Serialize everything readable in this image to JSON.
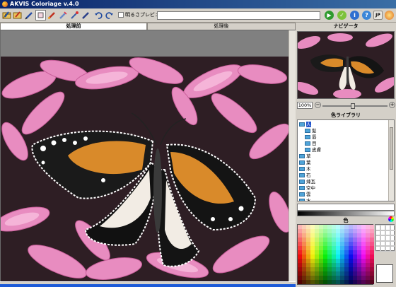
{
  "window": {
    "title": "AKVIS Coloriage v.4.0"
  },
  "toolbar": {
    "preview_label": "明るさプレビュー",
    "language_button": "JP",
    "icons": [
      "open-icon",
      "save-icon",
      "pencil-icon",
      "eraser-icon",
      "brush-icon",
      "lasso-icon",
      "eyedropper-icon",
      "fill-icon",
      "undo-icon",
      "redo-icon",
      "run-icon",
      "apply-icon",
      "info-icon",
      "help-icon",
      "language-icon",
      "settings-icon"
    ]
  },
  "tabs": {
    "before": "処理前",
    "after": "処理後"
  },
  "navigator": {
    "header": "ナビゲータ",
    "zoom": "100%"
  },
  "library": {
    "header": "色ライブラリ",
    "items": [
      {
        "label": "人",
        "indent": 0
      },
      {
        "label": "髪",
        "indent": 1
      },
      {
        "label": "唇",
        "indent": 1
      },
      {
        "label": "目",
        "indent": 1
      },
      {
        "label": "皮膚",
        "indent": 1
      },
      {
        "label": "草",
        "indent": 0
      },
      {
        "label": "葉",
        "indent": 0
      },
      {
        "label": "木",
        "indent": 0
      },
      {
        "label": "石",
        "indent": 0
      },
      {
        "label": "煉瓦",
        "indent": 0
      },
      {
        "label": "空中",
        "indent": 0
      },
      {
        "label": "雲",
        "indent": 0
      },
      {
        "label": "水",
        "indent": 0
      }
    ]
  },
  "color": {
    "header": "色"
  }
}
